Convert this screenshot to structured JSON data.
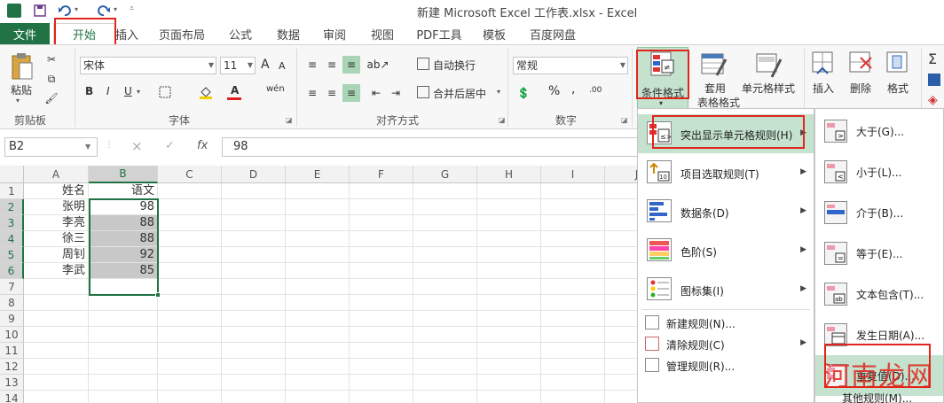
{
  "title_bar": {
    "title": "新建 Microsoft Excel 工作表.xlsx - Excel",
    "save_icon": "save-icon",
    "undo_icon": "undo-icon",
    "redo_icon": "redo-icon"
  },
  "tabs": {
    "file": "文件",
    "items": [
      "开始",
      "插入",
      "页面布局",
      "公式",
      "数据",
      "审阅",
      "视图",
      "PDF工具",
      "模板",
      "百度网盘"
    ]
  },
  "ribbon": {
    "clipboard": {
      "paste": "粘贴",
      "label": "剪贴板"
    },
    "font": {
      "name": "宋体",
      "size": "11",
      "bold": "B",
      "italic": "I",
      "underline": "U",
      "grow": "A",
      "shrink": "A",
      "phonetic": "wén",
      "font_color_letter": "A",
      "label": "字体"
    },
    "alignment": {
      "wrap": "自动换行",
      "merge": "合并后居中",
      "label": "对齐方式"
    },
    "number": {
      "format": "常规",
      "percent": "%",
      "comma": ",",
      "inc_decimal": ".00",
      "label": "数字"
    },
    "styles": {
      "conditional": "条件格式",
      "table_line1": "套用",
      "table_line2": "表格格式",
      "cell_styles": "单元格样式"
    },
    "cells": {
      "insert": "插入",
      "delete": "删除",
      "format": "格式"
    },
    "accent": "#217346"
  },
  "formula_bar": {
    "name_box": "B2",
    "cancel": "×",
    "enter": "✓",
    "fx": "fx",
    "content": "98"
  },
  "sheet": {
    "columns": [
      "A",
      "B",
      "C",
      "D",
      "E",
      "F",
      "G",
      "H",
      "I",
      "J"
    ],
    "rows": [
      "1",
      "2",
      "3",
      "4",
      "5",
      "6",
      "7",
      "8",
      "9",
      "10",
      "11",
      "12",
      "13",
      "14"
    ],
    "data": [
      [
        "姓名",
        "语文"
      ],
      [
        "张明",
        "98"
      ],
      [
        "李亮",
        "88"
      ],
      [
        "徐三",
        "88"
      ],
      [
        "周钊",
        "92"
      ],
      [
        "李武",
        "85"
      ]
    ]
  },
  "cf_menu": {
    "items": [
      {
        "label": "突出显示单元格规则(H)",
        "icon": "highlight-rules-icon"
      },
      {
        "label": "项目选取规则(T)",
        "icon": "top-bottom-rules-icon"
      },
      {
        "label": "数据条(D)",
        "icon": "data-bars-icon"
      },
      {
        "label": "色阶(S)",
        "icon": "color-scales-icon"
      },
      {
        "label": "图标集(I)",
        "icon": "icon-sets-icon"
      }
    ],
    "small_items": [
      {
        "label": "新建规则(N)...",
        "icon": "new-rule-icon"
      },
      {
        "label": "清除规则(C)",
        "icon": "clear-rules-icon"
      },
      {
        "label": "管理规则(R)...",
        "icon": "manage-rules-icon"
      }
    ]
  },
  "submenu": {
    "items": [
      {
        "label": "大于(G)...",
        "icon": "greater-than-icon"
      },
      {
        "label": "小于(L)...",
        "icon": "less-than-icon"
      },
      {
        "label": "介于(B)...",
        "icon": "between-icon"
      },
      {
        "label": "等于(E)...",
        "icon": "equal-to-icon"
      },
      {
        "label": "文本包含(T)...",
        "icon": "text-contains-icon"
      },
      {
        "label": "发生日期(A)...",
        "icon": "date-occurring-icon"
      },
      {
        "label": "重复值(D)...",
        "icon": "duplicate-values-icon"
      }
    ],
    "more": "其他规则(M)..."
  },
  "watermark": "河南龙网"
}
